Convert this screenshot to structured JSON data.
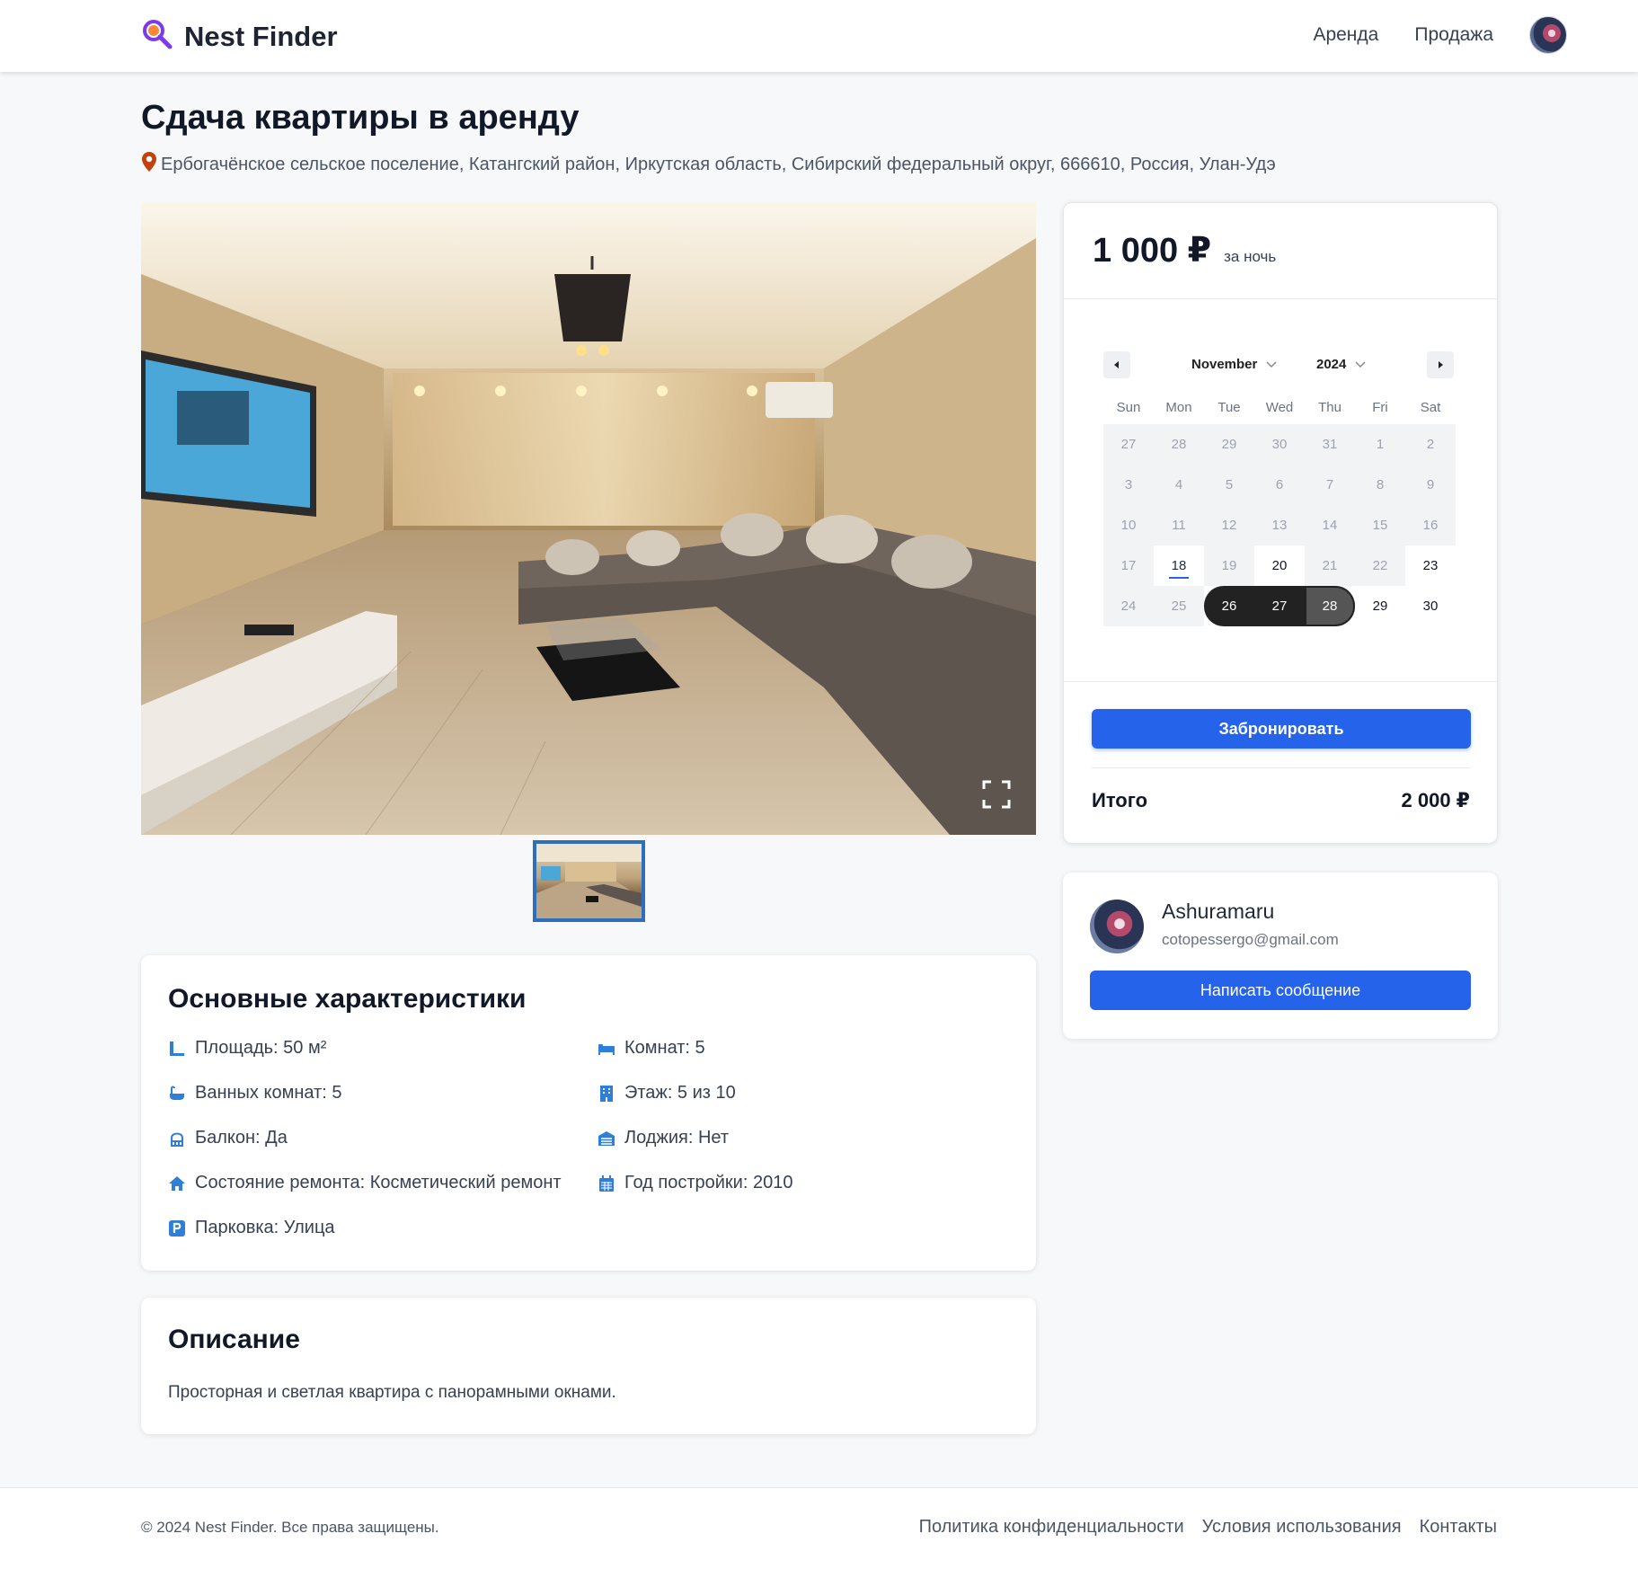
{
  "header": {
    "logo_text": "Nest Finder",
    "nav": [
      "Аренда",
      "Продажа"
    ]
  },
  "listing": {
    "title": "Сдача квартиры в аренду",
    "address": "Ербогачёнское сельское поселение, Катангский район, Иркутская область, Сибирский федеральный округ, 666610, Россия, Улан-Удэ"
  },
  "features": {
    "title": "Основные характеристики",
    "items": [
      {
        "icon": "ruler-icon",
        "text": "Площадь: 50 м²"
      },
      {
        "icon": "bed-icon",
        "text": "Комнат: 5"
      },
      {
        "icon": "bath-icon",
        "text": "Ванных комнат: 5"
      },
      {
        "icon": "building-icon",
        "text": "Этаж: 5 из 10"
      },
      {
        "icon": "balcony-icon",
        "text": "Балкон: Да"
      },
      {
        "icon": "loggia-icon",
        "text": "Лоджия: Нет"
      },
      {
        "icon": "home-icon",
        "text": "Состояние ремонта: Косметический ремонт"
      },
      {
        "icon": "calendar-icon",
        "text": "Год постройки: 2010"
      },
      {
        "icon": "parking-icon",
        "text": "Парковка: Улица"
      }
    ]
  },
  "description": {
    "title": "Описание",
    "text": "Просторная и светлая квартира с панорамными окнами."
  },
  "booking": {
    "price": "1 000 ₽",
    "per_night": "за ночь",
    "calendar": {
      "month": "November",
      "year": "2024",
      "weekdays": [
        "Sun",
        "Mon",
        "Tue",
        "Wed",
        "Thu",
        "Fri",
        "Sat"
      ],
      "weeks": [
        [
          "27",
          "28",
          "29",
          "30",
          "31",
          "1",
          "2"
        ],
        [
          "3",
          "4",
          "5",
          "6",
          "7",
          "8",
          "9"
        ],
        [
          "10",
          "11",
          "12",
          "13",
          "14",
          "15",
          "16"
        ],
        [
          "17",
          "18",
          "19",
          "20",
          "21",
          "22",
          "23"
        ],
        [
          "24",
          "25",
          "26",
          "27",
          "28",
          "29",
          "30"
        ]
      ],
      "today": "18",
      "selected_range": [
        "26",
        "28"
      ]
    },
    "book_label": "Забронировать",
    "total_label": "Итого",
    "total_value": "2 000 ₽"
  },
  "owner": {
    "name": "Ashuramaru",
    "email": "cotopessergo@gmail.com",
    "message_label": "Написать сообщение"
  },
  "footer": {
    "copyright": "© 2024 Nest Finder. Все права защищены.",
    "links": [
      "Политика конфиденциальности",
      "Условия использования",
      "Контакты"
    ]
  },
  "colors": {
    "accent": "#2563eb",
    "logo": "#7c3aed",
    "pin": "#c2410c"
  }
}
